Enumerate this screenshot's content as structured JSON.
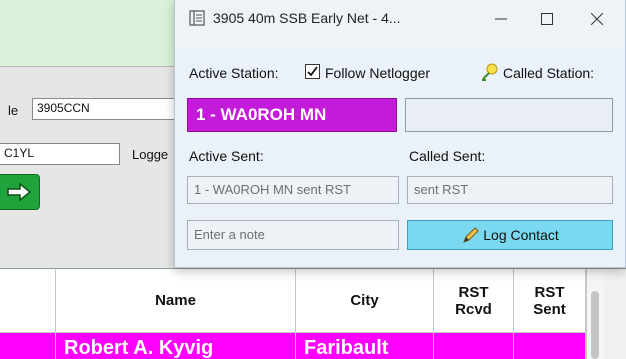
{
  "background_app": {
    "field_label_1": "le",
    "field_value_1": "3905CCN",
    "field_value_2": "C1YL",
    "field_label_2": "Logge"
  },
  "grid": {
    "columns": [
      "Name",
      "City",
      "RST Rcvd",
      "RST Sent"
    ],
    "row": {
      "name": "Robert A. Kyvig",
      "city": "Faribault",
      "rst_rcvd": "",
      "rst_sent": ""
    },
    "row_color": "#ff00ff"
  },
  "dialog": {
    "title": "3905 40m SSB Early Net - 4...",
    "active_station_label": "Active Station:",
    "follow_netlogger_label": "Follow Netlogger",
    "follow_netlogger_checked": true,
    "called_station_label": "Called Station:",
    "active_station_value": "1 - WA0ROH MN",
    "active_station_color": "#c41ad9",
    "called_station_value": "",
    "active_sent_label": "Active Sent:",
    "called_sent_label": "Called Sent:",
    "active_sent_value": "1 - WA0ROH MN sent RST",
    "called_sent_value": "sent RST",
    "note_placeholder": "Enter a note",
    "log_contact_label": "Log Contact",
    "log_button_color": "#7ad8f0"
  }
}
